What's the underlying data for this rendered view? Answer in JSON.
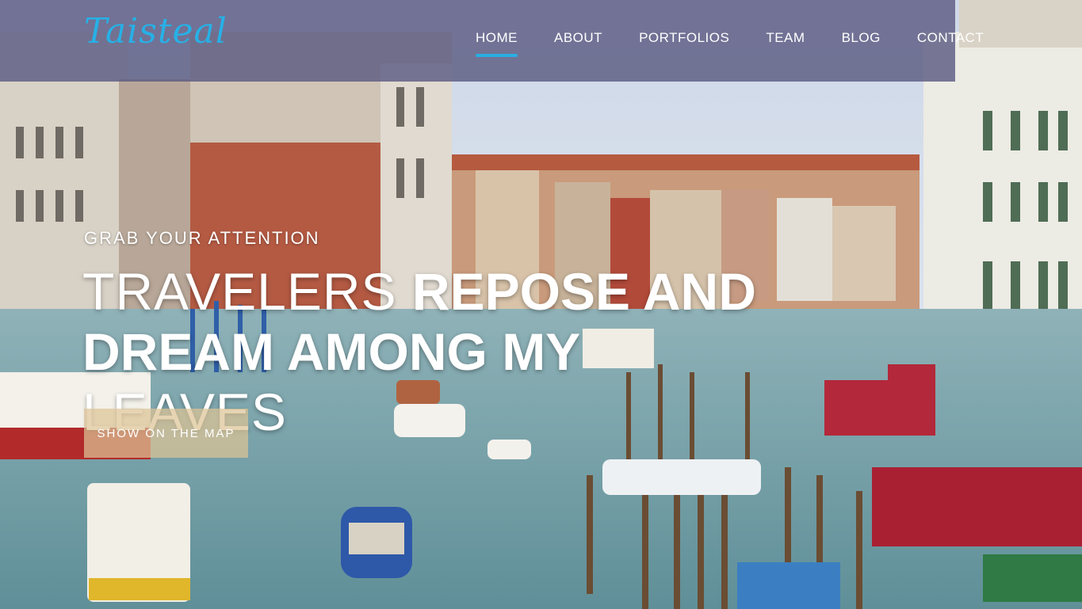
{
  "brand": {
    "logo_text": "Taisteal",
    "accent_color": "#29aee3"
  },
  "nav": {
    "items": [
      {
        "label": "HOME",
        "active": true
      },
      {
        "label": "ABOUT",
        "active": false
      },
      {
        "label": "PORTFOLIOS",
        "active": false
      },
      {
        "label": "TEAM",
        "active": false
      },
      {
        "label": "BLOG",
        "active": false
      },
      {
        "label": "CONTACT",
        "active": false
      }
    ]
  },
  "hero": {
    "kicker": "GRAB YOUR ATTENTION",
    "title_part1_light": "TRAVELERS ",
    "title_part1_bold": "REPOSE AND",
    "title_part2_bold": "DREAM AMONG MY ",
    "title_part2_light": "LEAVES",
    "button_label": "SHOW ON THE MAP",
    "background_image": "venice-grand-canal-photo"
  }
}
